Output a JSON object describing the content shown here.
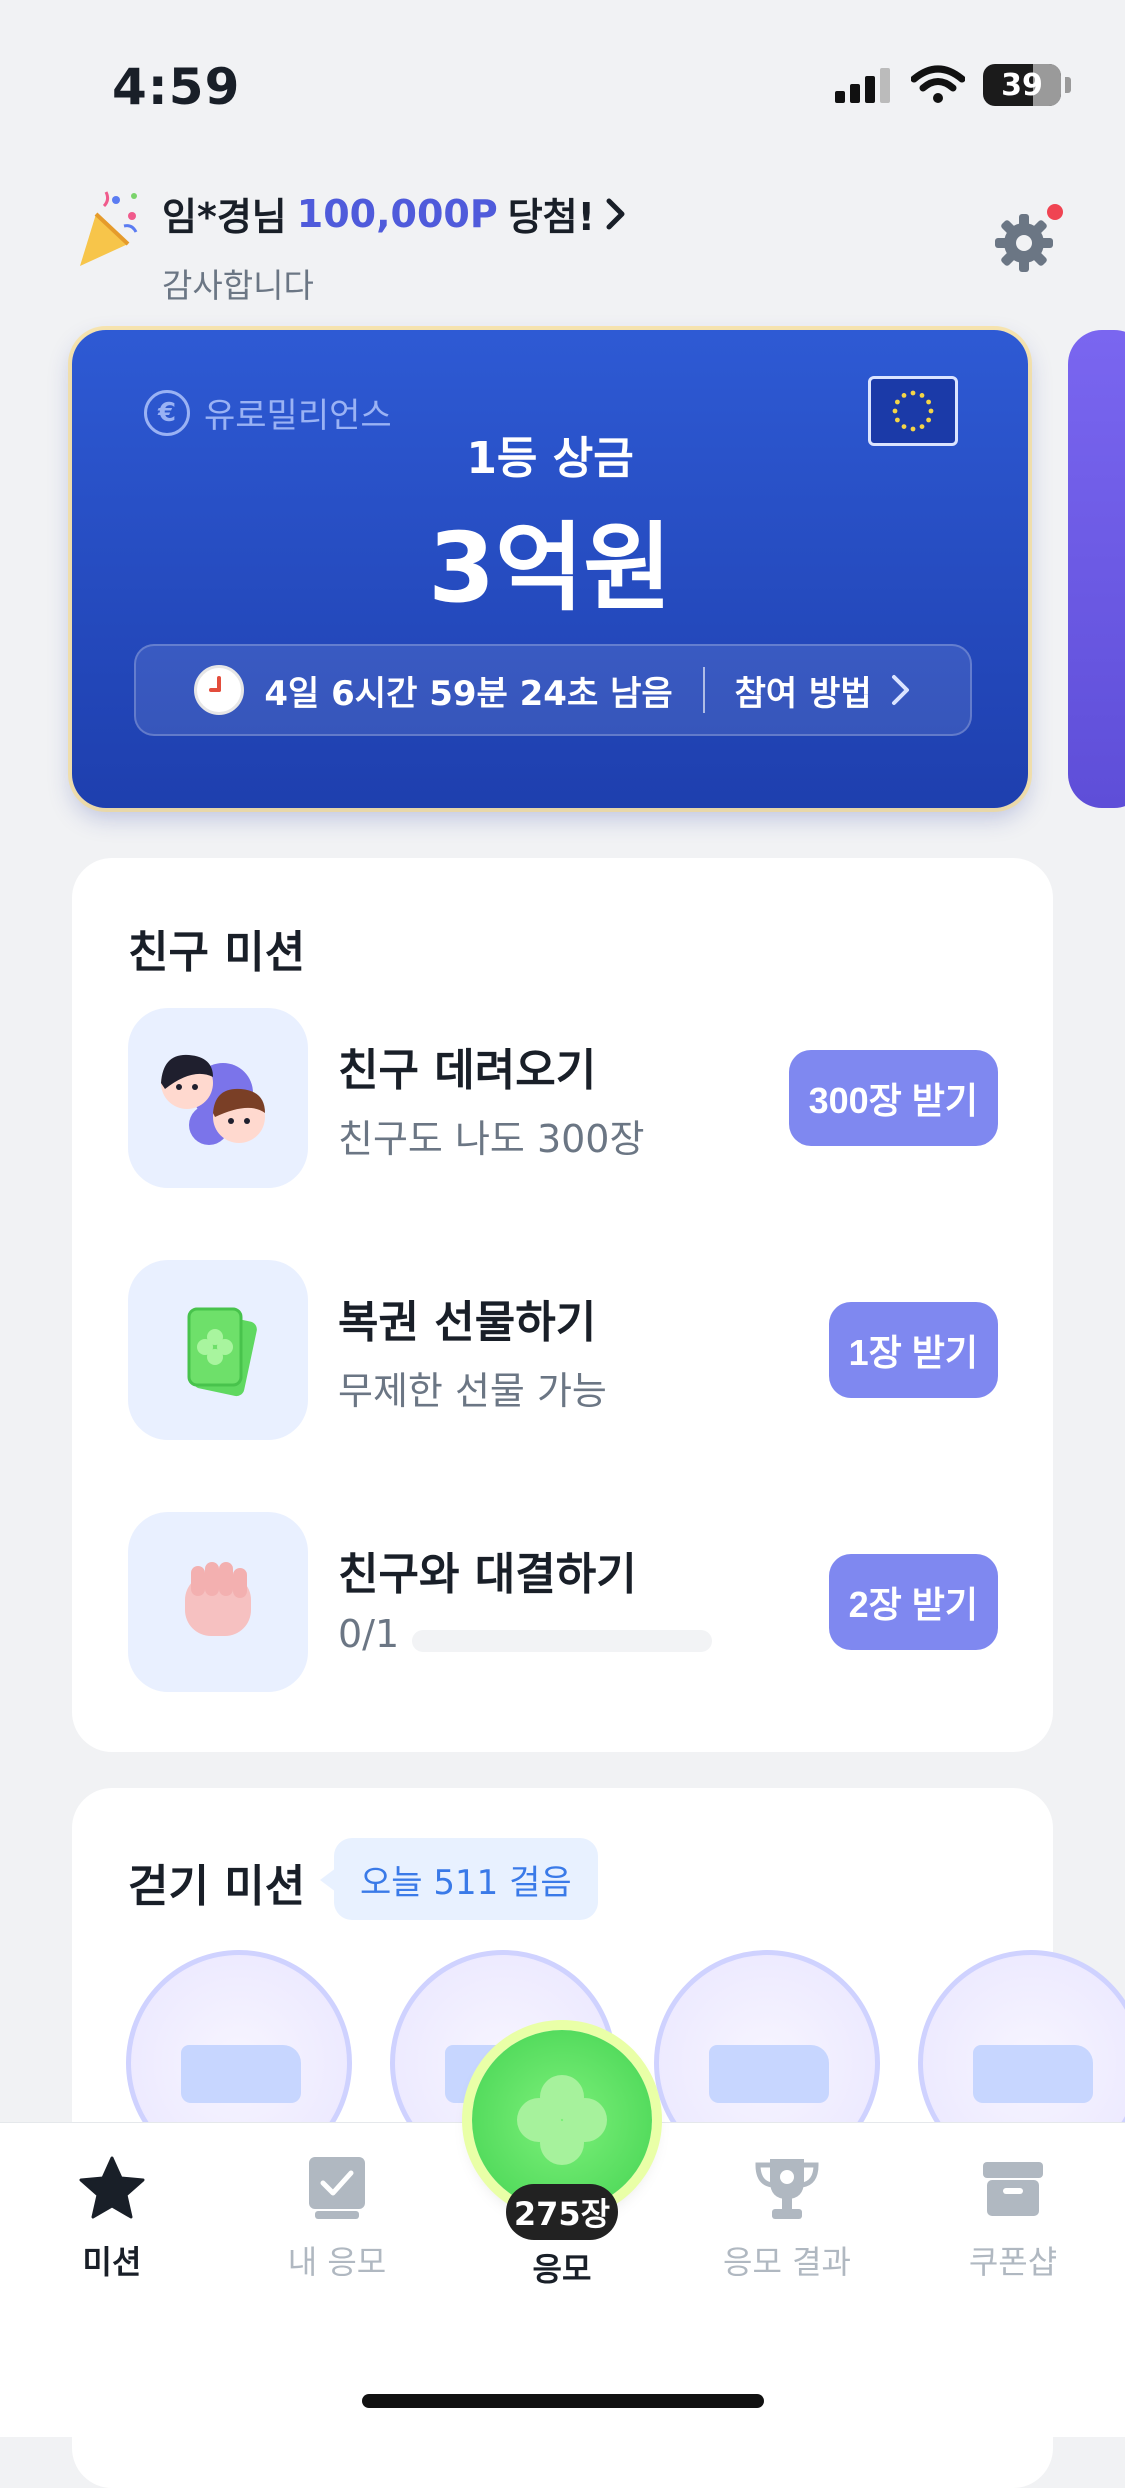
{
  "status_bar": {
    "time": "4:59",
    "battery": "39"
  },
  "winner_banner": {
    "name": "임*경님",
    "points": "100,000P",
    "suffix": "당첨!",
    "subtitle": "감사합니다"
  },
  "prize_card": {
    "brand": "유로밀리언스",
    "label": "1등 상금",
    "amount": "3억원",
    "countdown": "4일 6시간 59분 24초 남음",
    "how_to": "참여 방법"
  },
  "friend_mission": {
    "title": "친구 미션",
    "items": [
      {
        "title": "친구 데려오기",
        "subtitle": "친구도 나도 300장",
        "button": "300장 받기"
      },
      {
        "title": "복권 선물하기",
        "subtitle": "무제한 선물 가능",
        "button": "1장 받기"
      },
      {
        "title": "친구와 대결하기",
        "subtitle": "0/1",
        "button": "2장 받기",
        "progress": 0.0
      }
    ]
  },
  "walk_mission": {
    "title": "걷기 미션",
    "badge": "오늘 511 걸음"
  },
  "bottom_nav": {
    "items": [
      {
        "label": "미션",
        "icon": "star-icon",
        "active": true
      },
      {
        "label": "내 응모",
        "icon": "checkbox-icon",
        "active": false
      },
      {
        "label": "응모",
        "icon": "clover-icon",
        "active": true
      },
      {
        "label": "응모 결과",
        "icon": "trophy-icon",
        "active": false
      },
      {
        "label": "쿠폰샵",
        "icon": "archive-box-icon",
        "active": false
      }
    ],
    "apply_count": "275장"
  },
  "colors": {
    "accent": "#7f88f0",
    "highlight": "#4f5bdb",
    "prize_blue": "#2e5ad4",
    "clover_green": "#55dc5e"
  }
}
